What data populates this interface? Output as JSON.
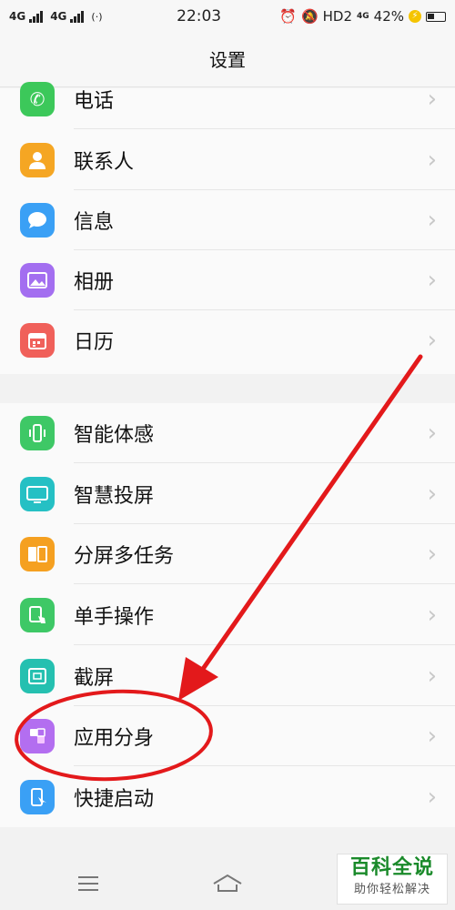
{
  "status_bar": {
    "network1": "4G",
    "network2": "4G",
    "time": "22:03",
    "hd": "HD2",
    "small_4g": "4G",
    "battery": "42%"
  },
  "title": "设置",
  "groups": [
    {
      "items": [
        {
          "label": "电话",
          "icon": "phone-icon",
          "color": "#3cc85a"
        },
        {
          "label": "联系人",
          "icon": "contacts-icon",
          "color": "#f5a623"
        },
        {
          "label": "信息",
          "icon": "message-icon",
          "color": "#3aa0f5"
        },
        {
          "label": "相册",
          "icon": "album-icon",
          "color": "#a36ef0"
        },
        {
          "label": "日历",
          "icon": "calendar-icon",
          "color": "#f0605a"
        }
      ]
    },
    {
      "items": [
        {
          "label": "智能体感",
          "icon": "smart-motion-icon",
          "color": "#3ec866"
        },
        {
          "label": "智慧投屏",
          "icon": "screen-cast-icon",
          "color": "#25c0c4"
        },
        {
          "label": "分屏多任务",
          "icon": "split-screen-icon",
          "color": "#f5a020"
        },
        {
          "label": "单手操作",
          "icon": "one-hand-icon",
          "color": "#3ec866"
        },
        {
          "label": "截屏",
          "icon": "screenshot-icon",
          "color": "#25c0b0"
        },
        {
          "label": "应用分身",
          "icon": "app-clone-icon",
          "color": "#b36ef0"
        },
        {
          "label": "快捷启动",
          "icon": "quick-launch-icon",
          "color": "#3aa0f5"
        }
      ]
    }
  ],
  "watermark": {
    "title": "百科全说",
    "subtitle": "助你轻松解决"
  },
  "annotation_color": "#e3191b"
}
